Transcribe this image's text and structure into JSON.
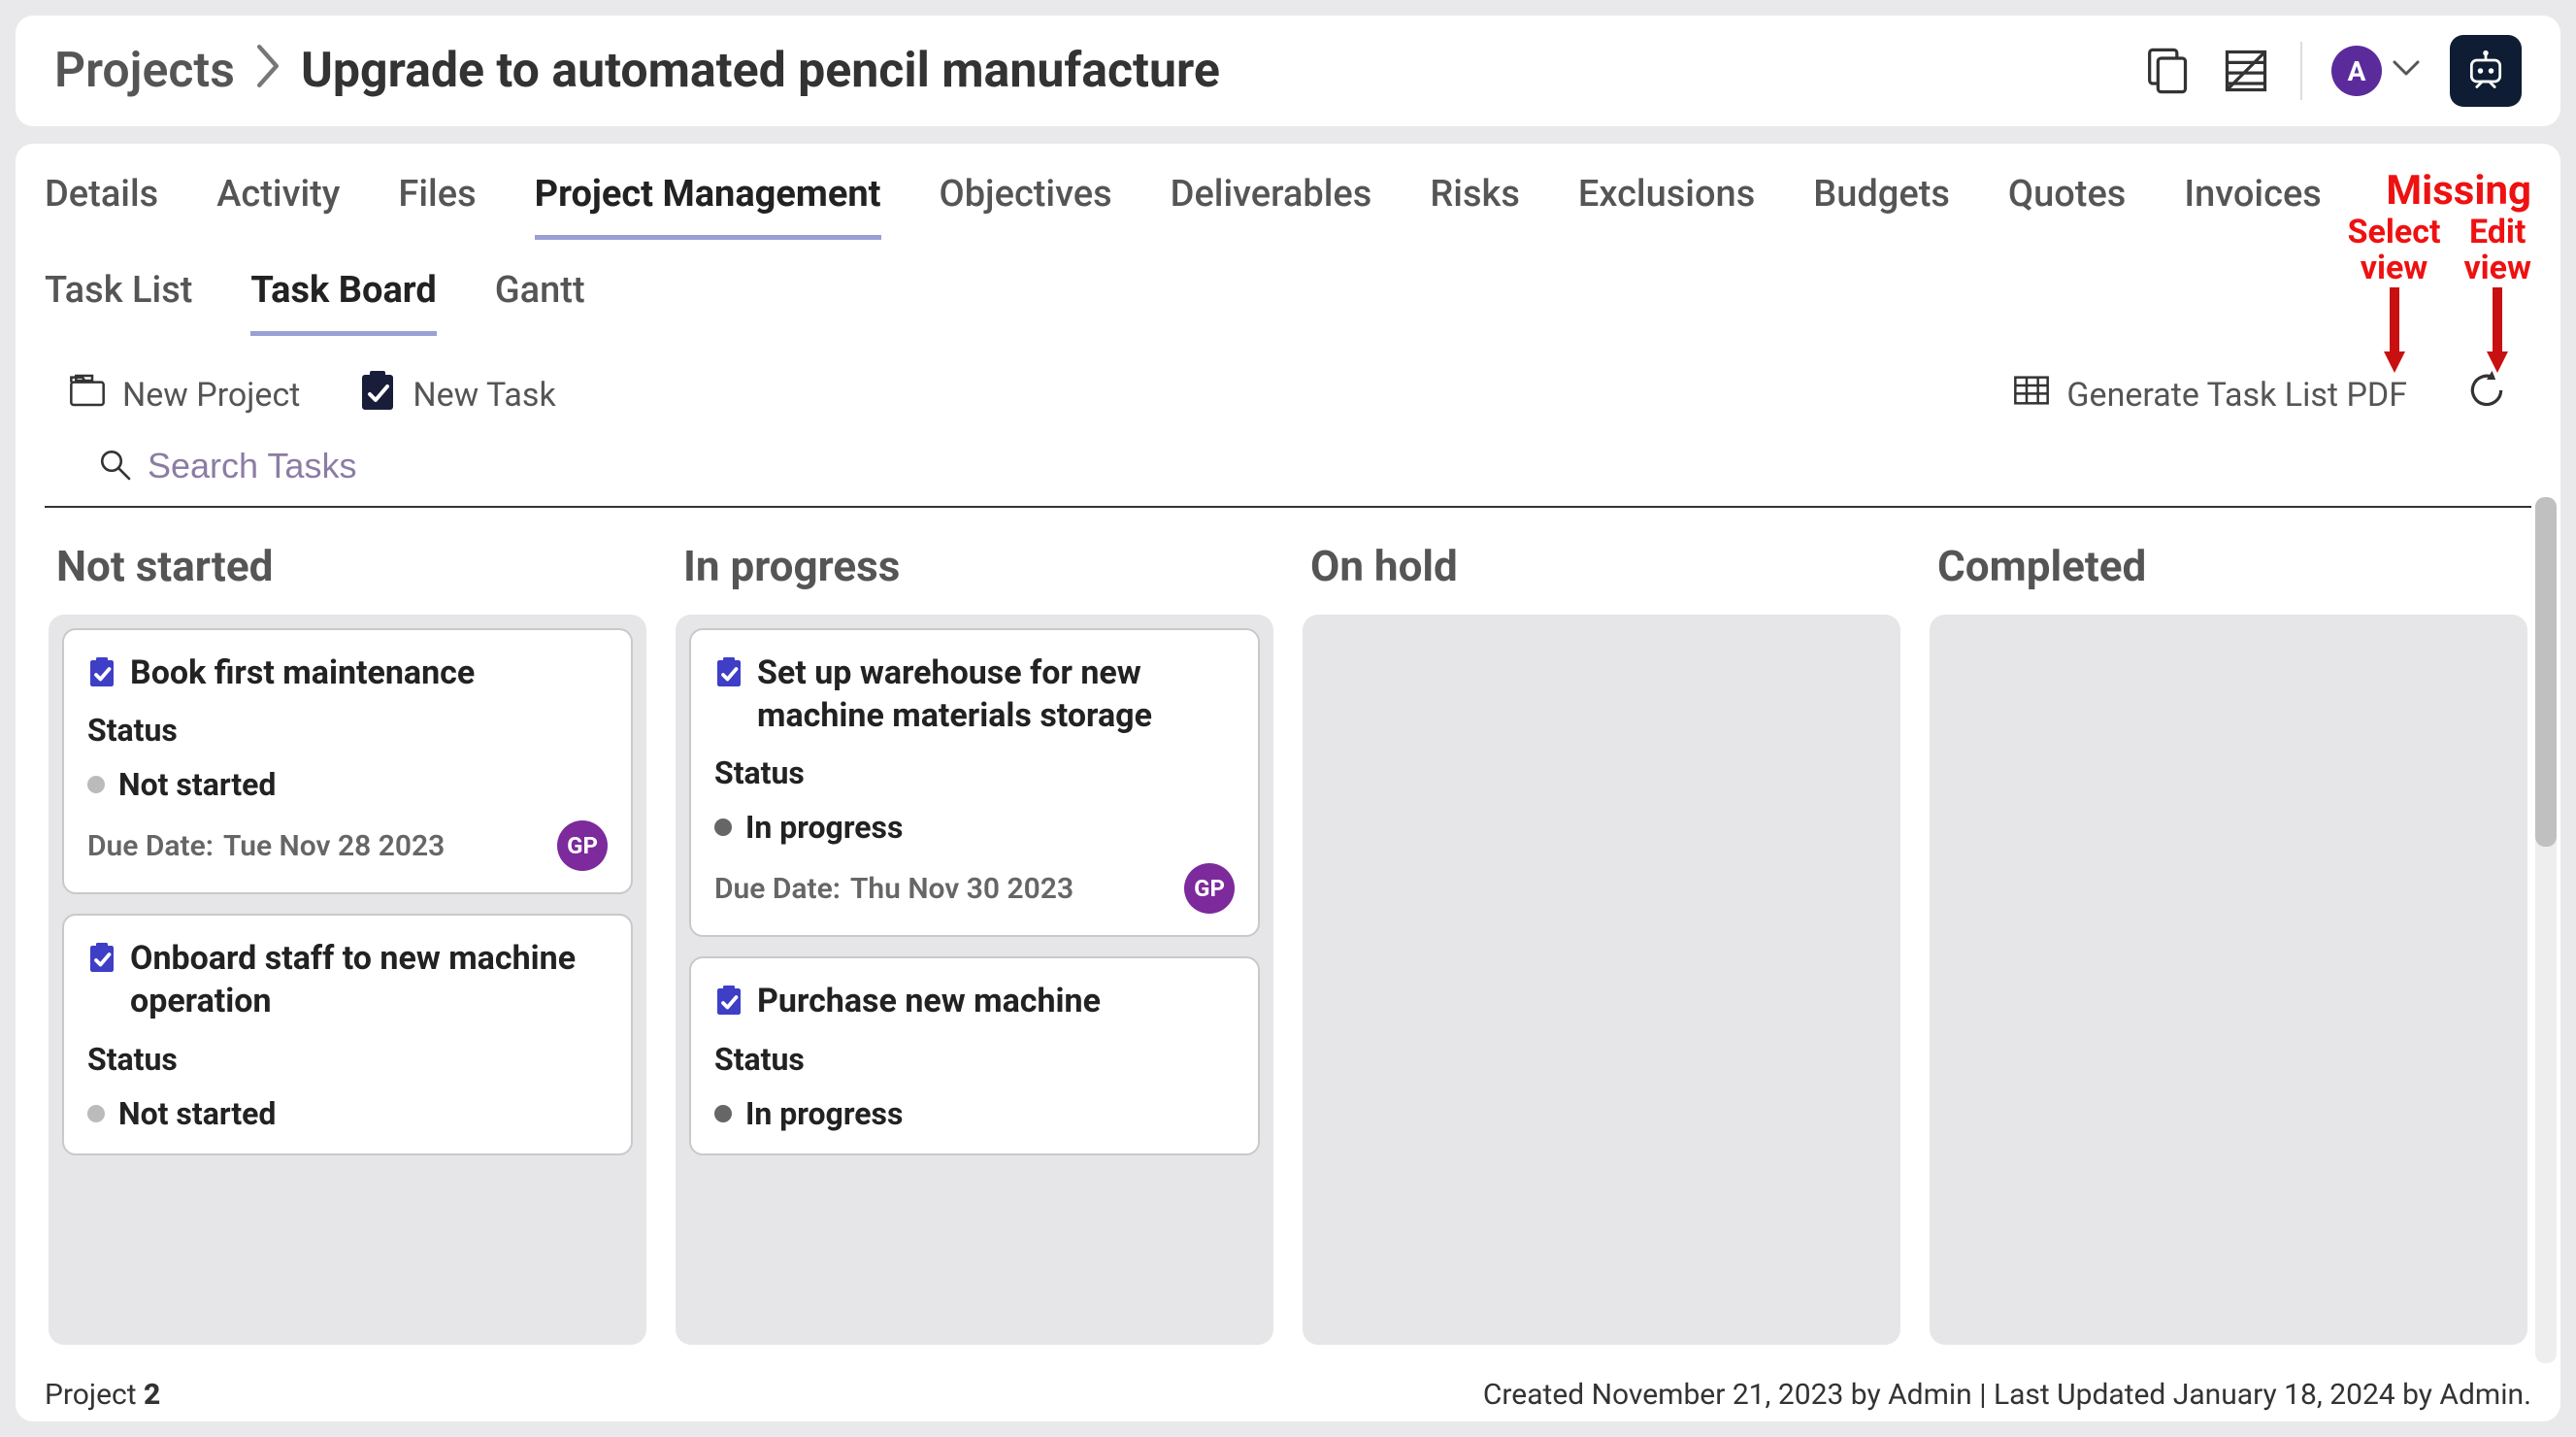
{
  "breadcrumb": {
    "root": "Projects",
    "current": "Upgrade to automated pencil manufacture"
  },
  "header": {
    "avatar_initial": "A"
  },
  "tabs_primary": [
    {
      "label": "Details",
      "active": false
    },
    {
      "label": "Activity",
      "active": false
    },
    {
      "label": "Files",
      "active": false
    },
    {
      "label": "Project Management",
      "active": true
    },
    {
      "label": "Objectives",
      "active": false
    },
    {
      "label": "Deliverables",
      "active": false
    },
    {
      "label": "Risks",
      "active": false
    },
    {
      "label": "Exclusions",
      "active": false
    },
    {
      "label": "Budgets",
      "active": false
    },
    {
      "label": "Quotes",
      "active": false
    },
    {
      "label": "Invoices",
      "active": false
    }
  ],
  "annotation": {
    "missing": "Missing",
    "select_view_l1": "Select",
    "select_view_l2": "view",
    "edit_view_l1": "Edit",
    "edit_view_l2": "view"
  },
  "tabs_secondary": [
    {
      "label": "Task List",
      "active": false
    },
    {
      "label": "Task Board",
      "active": true
    },
    {
      "label": "Gantt",
      "active": false
    }
  ],
  "toolbar": {
    "new_project": "New Project",
    "new_task": "New Task",
    "generate_pdf": "Generate Task List PDF"
  },
  "search": {
    "placeholder": "Search Tasks"
  },
  "board": {
    "columns": [
      {
        "title": "Not started",
        "cards": [
          {
            "title": "Book first maintenance",
            "status_label": "Status",
            "status_value": "Not started",
            "status_dot": "not-started",
            "due_label": "Due Date:",
            "due_value": "Tue Nov 28 2023",
            "assignee": "GP"
          },
          {
            "title": "Onboard staff to new machine operation",
            "status_label": "Status",
            "status_value": "Not started",
            "status_dot": "not-started",
            "due_label": "",
            "due_value": "",
            "assignee": ""
          }
        ]
      },
      {
        "title": "In progress",
        "cards": [
          {
            "title": "Set up warehouse for new machine materials storage",
            "status_label": "Status",
            "status_value": "In progress",
            "status_dot": "in-progress",
            "due_label": "Due Date:",
            "due_value": "Thu Nov 30 2023",
            "assignee": "GP"
          },
          {
            "title": "Purchase new machine",
            "status_label": "Status",
            "status_value": "In progress",
            "status_dot": "in-progress",
            "due_label": "",
            "due_value": "",
            "assignee": ""
          }
        ]
      },
      {
        "title": "On hold",
        "cards": []
      },
      {
        "title": "Completed",
        "cards": []
      }
    ]
  },
  "footer": {
    "project_label": "Project",
    "project_number": "2",
    "meta": "Created November 21, 2023 by Admin | Last Updated January 18, 2024 by Admin."
  }
}
